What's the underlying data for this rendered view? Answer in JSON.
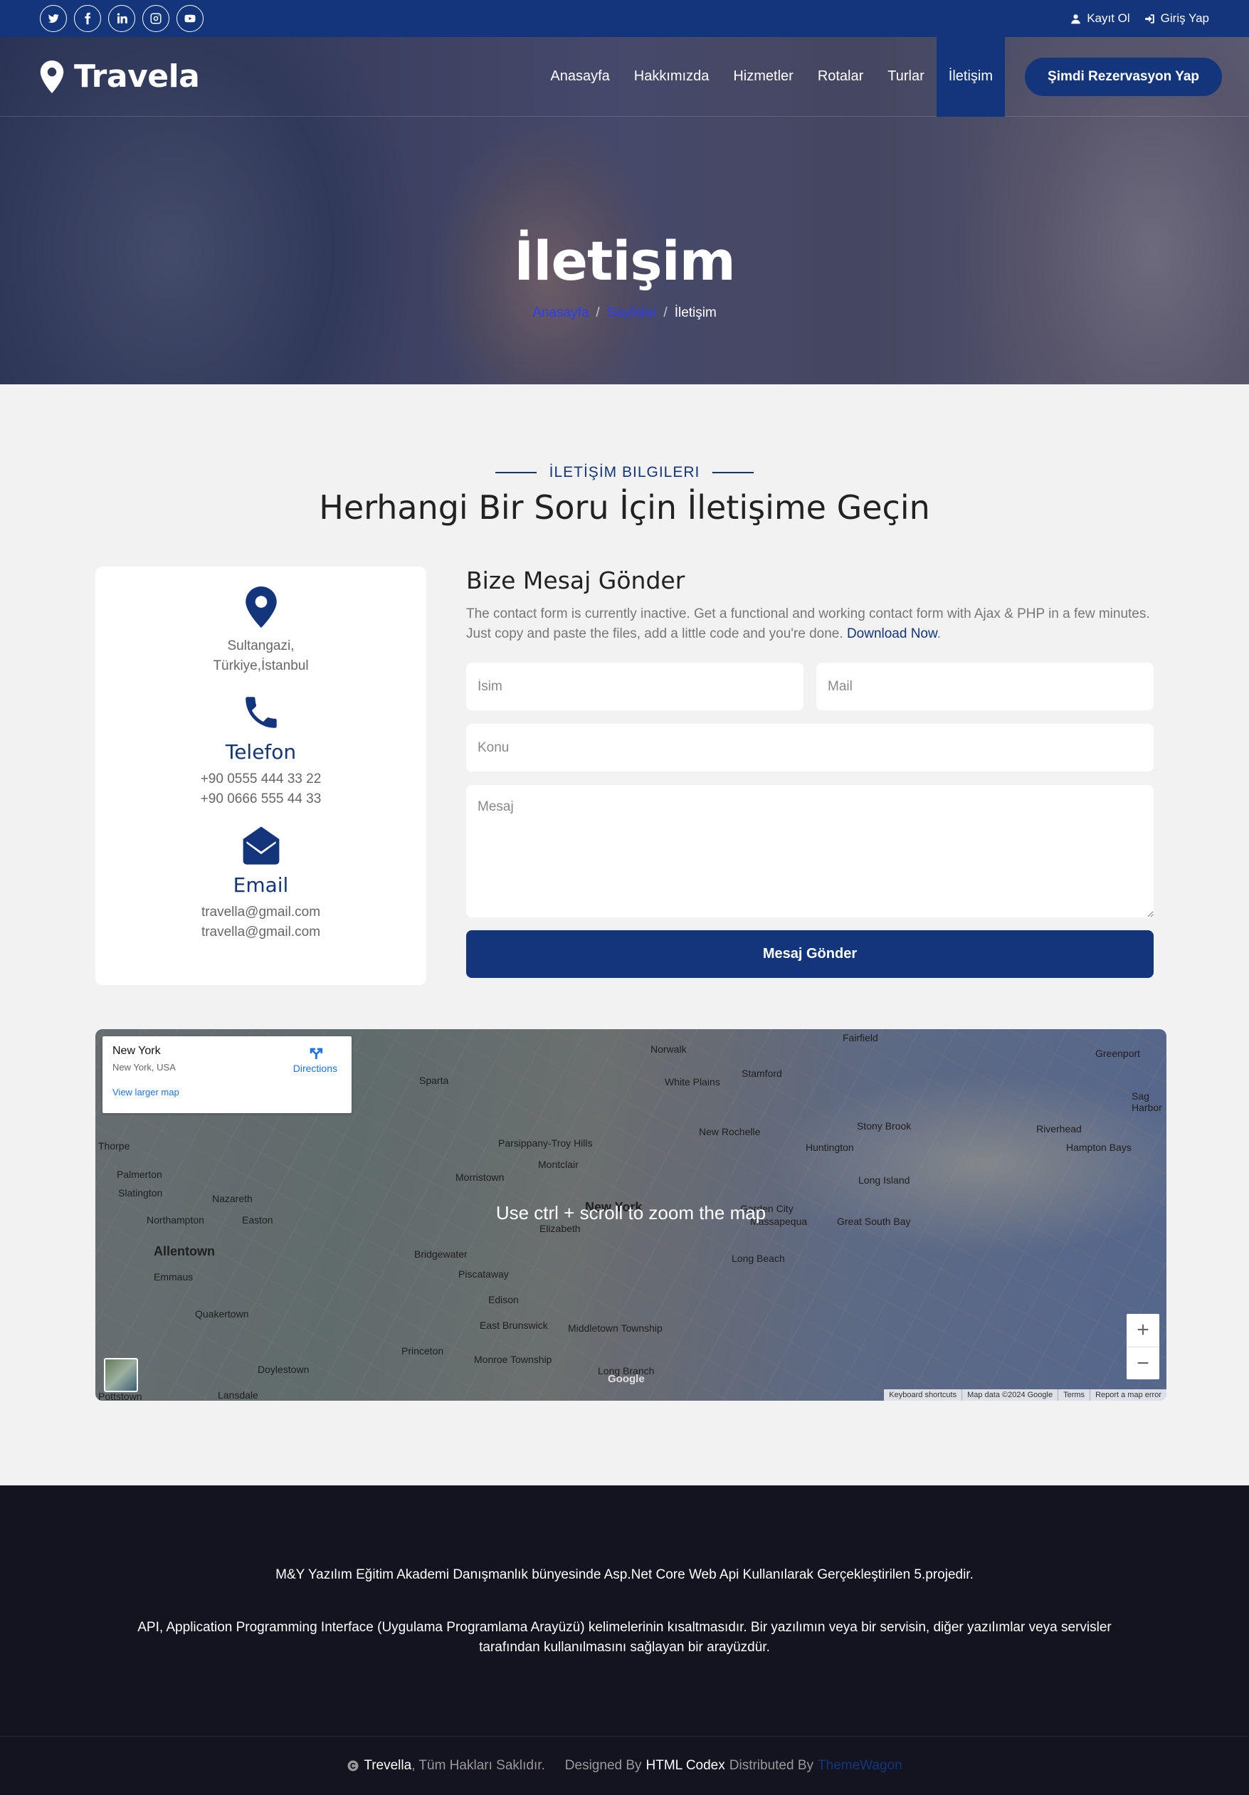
{
  "topbar": {
    "socials": [
      "twitter-icon",
      "facebook-icon",
      "linkedin-icon",
      "instagram-icon",
      "youtube-icon"
    ],
    "register": "Kayıt Ol",
    "login": "Giriş Yap"
  },
  "brand": {
    "name": "Travela"
  },
  "nav": {
    "items": [
      "Anasayfa",
      "Hakkımızda",
      "Hizmetler",
      "Rotalar",
      "Turlar",
      "İletişim"
    ],
    "active": "İletişim",
    "cta": "Şimdi Rezervasyon Yap"
  },
  "hero": {
    "title": "İletişim",
    "breadcrumb": [
      "Anasayfa",
      "Sayfalar",
      "İletişim"
    ]
  },
  "section": {
    "eyebrow": "İLETİŞİM BILGILERI",
    "title": "Herhangi Bir Soru İçin İletişime Geçin"
  },
  "info": {
    "address": [
      "Sultangazi,",
      "Türkiye,İstanbul"
    ],
    "phone_title": "Telefon",
    "phones": [
      "+90 0555 444 33 22",
      "+90 0666 555 44 33"
    ],
    "email_title": "Email",
    "emails": [
      "travella@gmail.com",
      "travella@gmail.com"
    ]
  },
  "form": {
    "title": "Bize Mesaj Gönder",
    "description": "The contact form is currently inactive. Get a functional and working contact form with Ajax & PHP in a few minutes. Just copy and paste the files, add a little code and you're done.",
    "download_link": "Download Now",
    "name_placeholder": "İsim",
    "mail_placeholder": "Mail",
    "subject_placeholder": "Konu",
    "message_placeholder": "Mesaj",
    "submit": "Mesaj Gönder"
  },
  "map": {
    "card_title": "New York",
    "card_subtitle": "New York, USA",
    "directions": "Directions",
    "larger_map": "View larger map",
    "hint": "Use ctrl + scroll to zoom the map",
    "places": [
      "Norwalk",
      "Fairfield",
      "Stamford",
      "White Plains",
      "Sparta",
      "New Rochelle",
      "Huntington",
      "Stony Brook",
      "Riverhead",
      "Greenport",
      "Sag Harbor",
      "Hampton Bays",
      "Parsippany-Troy Hills",
      "Montclair",
      "Morristown",
      "Palmerton",
      "Slatington",
      "Nazareth",
      "Northampton",
      "Easton",
      "Allentown",
      "Emmaus",
      "Quakertown",
      "Bridgewater",
      "Piscataway",
      "Edison",
      "Elizabeth",
      "New York",
      "Garden City",
      "Massapequa",
      "Long Beach",
      "Long Island",
      "Great South Bay",
      "East Brunswick",
      "Middletown Township",
      "Princeton",
      "Monroe Township",
      "Doylestown",
      "Long Branch",
      "Lansdale",
      "Pottstown",
      "Thorpe"
    ],
    "zoom_in": "+",
    "zoom_out": "−",
    "footer": [
      "Keyboard shortcuts",
      "Map data ©2024 Google",
      "Terms",
      "Report a map error"
    ],
    "logo": "Google"
  },
  "footer": {
    "line1": "M&Y Yazılım Eğitim Akademi Danışmanlık bünyesinde Asp.Net Core Web Api Kullanılarak Gerçekleştirilen 5.projedir.",
    "line2": "API, Application Programming Interface (Uygulama Programlama Arayüzü) kelimelerinin kısaltmasıdır. Bir yazılımın veya bir servisin, diğer yazılımlar veya servisler tarafından kullanılmasını sağlayan bir arayüzdür.",
    "brand": "Trevella",
    "rights": ", Tüm Hakları Saklıdır.",
    "designed_by": "Designed By",
    "designer": "HTML Codex",
    "distributed_by": "Distributed By",
    "distributor": "ThemeWagon"
  },
  "colors": {
    "primary": "#13357b",
    "footer_bg": "#13141f"
  }
}
